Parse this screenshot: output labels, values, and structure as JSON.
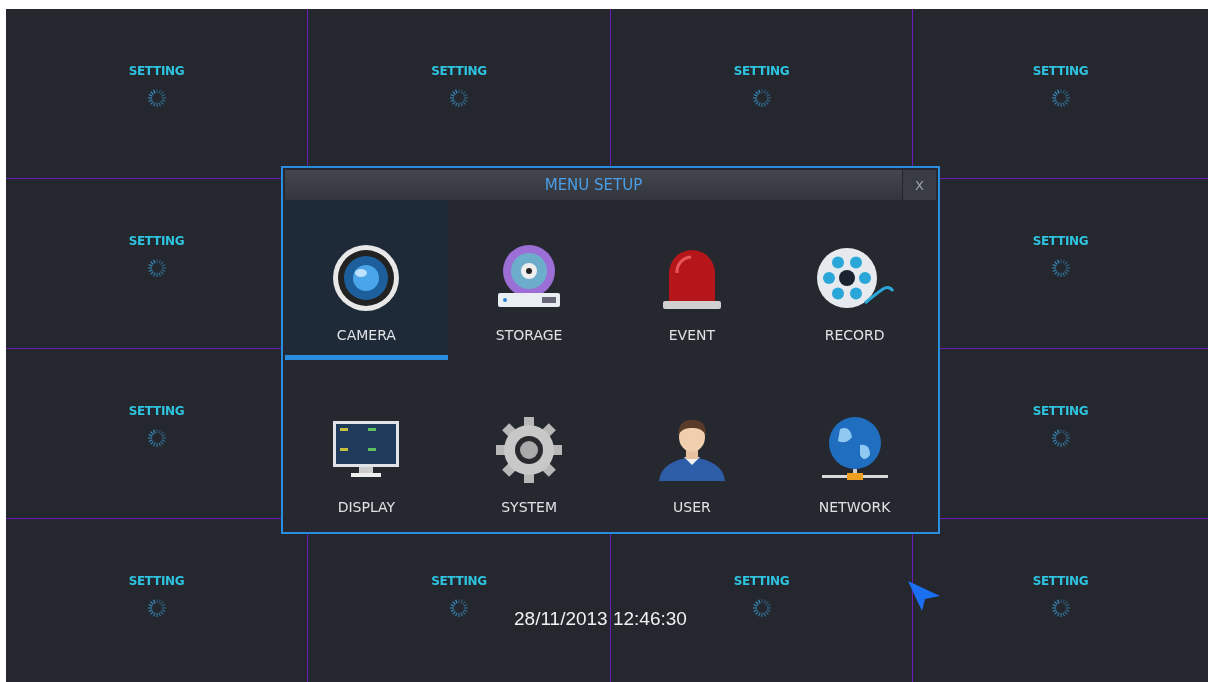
{
  "tiles": [
    {
      "label": "SETTING"
    },
    {
      "label": "SETTING"
    },
    {
      "label": "SETTING"
    },
    {
      "label": "SETTING"
    },
    {
      "label": "SETTING"
    },
    {
      "label": "SETTING"
    },
    {
      "label": "SETTING"
    },
    {
      "label": "SETTING"
    },
    {
      "label": "SETTING"
    },
    {
      "label": "SETTING"
    },
    {
      "label": "SETTING"
    },
    {
      "label": "SETTING"
    }
  ],
  "dialog": {
    "title": "MENU SETUP",
    "close": "X",
    "items": [
      {
        "kind": "camera",
        "label": "CAMERA",
        "selected": true
      },
      {
        "kind": "storage",
        "label": "STORAGE",
        "selected": false
      },
      {
        "kind": "event",
        "label": "EVENT",
        "selected": false
      },
      {
        "kind": "record",
        "label": "RECORD",
        "selected": false
      },
      {
        "kind": "display",
        "label": "DISPLAY",
        "selected": false
      },
      {
        "kind": "system",
        "label": "SYSTEM",
        "selected": false
      },
      {
        "kind": "user",
        "label": "USER",
        "selected": false
      },
      {
        "kind": "network",
        "label": "NETWORK",
        "selected": false
      }
    ]
  },
  "datetime": "28/11/2013 12:46:30"
}
